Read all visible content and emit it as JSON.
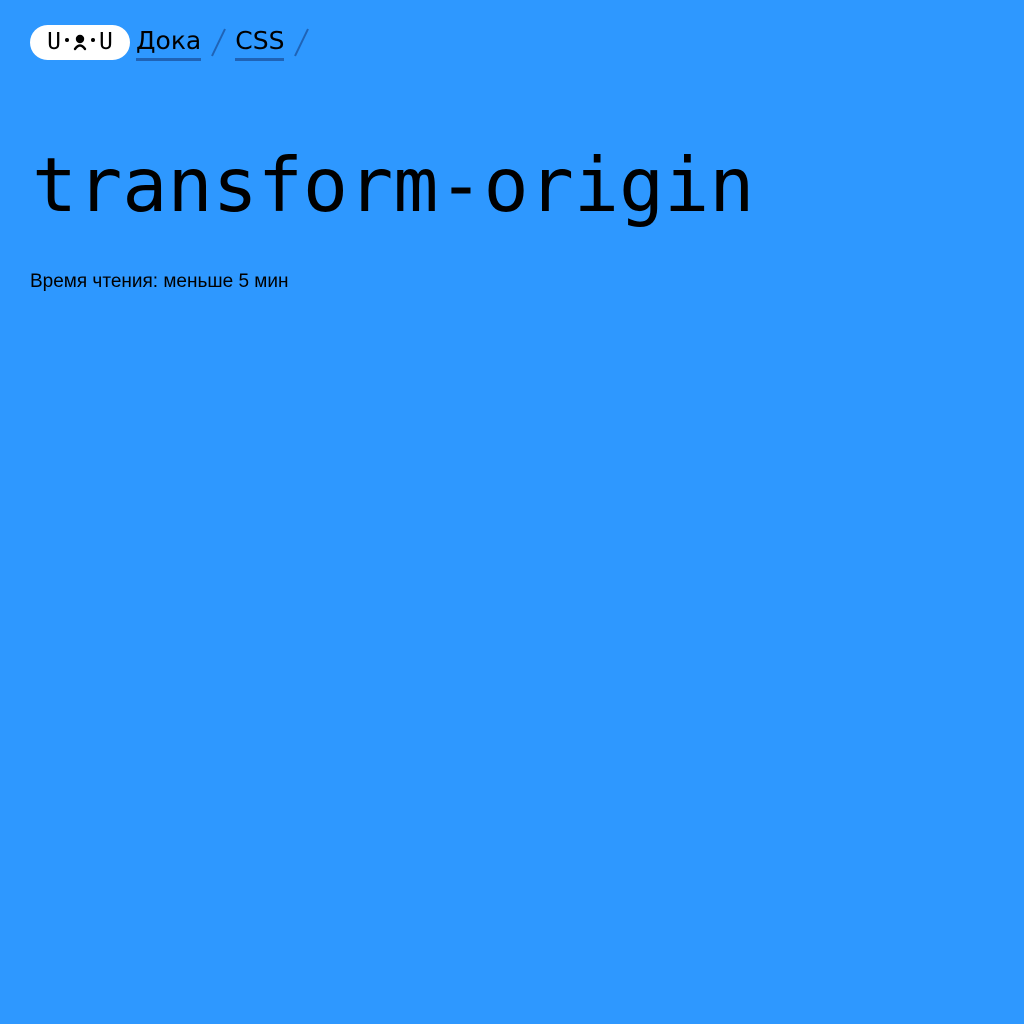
{
  "header": {
    "logo_text": "U•ᴥ•U",
    "breadcrumbs": [
      {
        "label": "Дока"
      },
      {
        "label": "CSS"
      }
    ]
  },
  "article": {
    "title": "transform-origin",
    "reading_time": "Время чтения: меньше 5 мин"
  },
  "colors": {
    "background": "#2e98ff",
    "logo_background": "#ffffff",
    "link_underline": "#1f63b6"
  }
}
